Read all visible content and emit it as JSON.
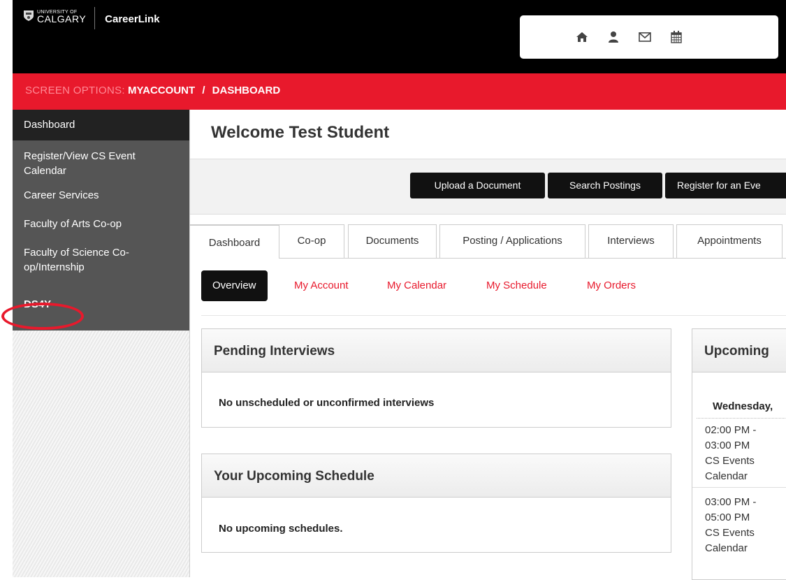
{
  "header": {
    "university_small": "UNIVERSITY OF",
    "university_big": "CALGARY",
    "app_name": "CareerLink",
    "icons": [
      "home-icon",
      "user-icon",
      "mail-icon",
      "calendar-icon"
    ]
  },
  "breadcrumb": {
    "screen_options": "SCREEN OPTIONS:",
    "items": [
      "MYACCOUNT",
      "DASHBOARD"
    ],
    "separator": "/"
  },
  "sidebar": {
    "items": [
      {
        "label": "Dashboard",
        "active": true
      },
      {
        "label": "Register/View CS Event Calendar"
      },
      {
        "label": "Career Services"
      },
      {
        "label": "Faculty of Arts Co-op"
      },
      {
        "label": "Faculty of Science Co-op/Internship"
      },
      {
        "label": "DS4Y"
      }
    ]
  },
  "main": {
    "title": "Welcome Test Student",
    "actions": [
      "Upload a Document",
      "Search Postings",
      "Register for an Eve"
    ],
    "tabs": [
      "Dashboard",
      "Co-op",
      "Documents",
      "Posting / Applications",
      "Interviews",
      "Appointments"
    ],
    "subnav": [
      "Overview",
      "My Account",
      "My Calendar",
      "My Schedule",
      "My Orders"
    ],
    "pending_interviews": {
      "title": "Pending Interviews",
      "message": "No unscheduled or unconfirmed interviews"
    },
    "upcoming_schedule": {
      "title": "Your Upcoming Schedule",
      "message": "No upcoming schedules."
    },
    "upcoming_events": {
      "title": "Upcoming",
      "date": "Wednesday,",
      "events": [
        {
          "start": "02:00 PM -",
          "end": "03:00 PM",
          "cal1": "CS Events",
          "cal2": "Calendar"
        },
        {
          "start": "03:00 PM -",
          "end": "05:00 PM",
          "cal1": "CS Events",
          "cal2": "Calendar"
        }
      ]
    }
  },
  "colors": {
    "brand_red": "#e8192c",
    "header_black": "#000000",
    "tab_accent": "#f39200"
  }
}
